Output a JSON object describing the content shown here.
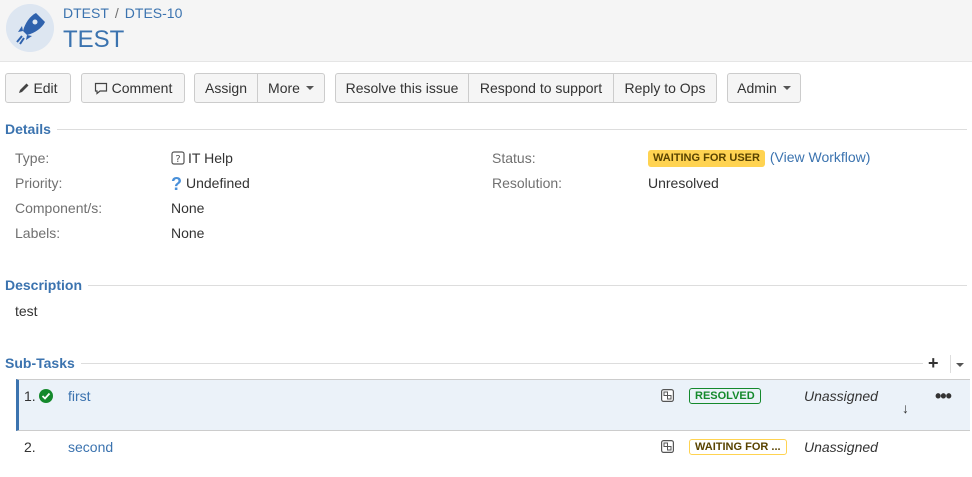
{
  "breadcrumb": {
    "project": "DTEST",
    "issue_key": "DTES-10",
    "separator": "/"
  },
  "issue": {
    "title": "TEST"
  },
  "toolbar": {
    "edit": "Edit",
    "comment": "Comment",
    "assign": "Assign",
    "more": "More",
    "resolve": "Resolve this issue",
    "respond": "Respond to support",
    "reply_ops": "Reply to Ops",
    "admin": "Admin"
  },
  "details": {
    "heading": "Details",
    "type_label": "Type:",
    "type_value": "IT Help",
    "priority_label": "Priority:",
    "priority_value": "Undefined",
    "components_label": "Component/s:",
    "components_value": "None",
    "labels_label": "Labels:",
    "labels_value": "None",
    "status_label": "Status:",
    "status_value": "WAITING FOR USER",
    "view_workflow": "(View Workflow)",
    "resolution_label": "Resolution:",
    "resolution_value": "Unresolved"
  },
  "description": {
    "heading": "Description",
    "text": "test"
  },
  "subtasks": {
    "heading": "Sub-Tasks",
    "rows": [
      {
        "num": "1.",
        "summary": "first",
        "status": "RESOLVED",
        "assignee": "Unassigned"
      },
      {
        "num": "2.",
        "summary": "second",
        "status": "WAITING FOR ...",
        "assignee": "Unassigned"
      }
    ]
  },
  "colors": {
    "link": "#3b73af",
    "status_waiting": "#ffd351",
    "status_resolved": "#14892c",
    "selected_row": "#ebf2f9"
  }
}
